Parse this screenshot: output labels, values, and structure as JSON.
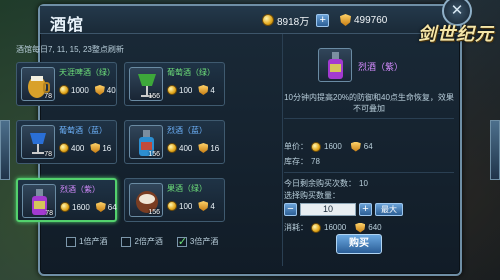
{
  "window": {
    "title": "酒馆"
  },
  "resources": {
    "gold": "8918万",
    "gems": "499760"
  },
  "logo": "剑世纪元",
  "notice": "酒馆每日7, 11, 15, 23整点刷新",
  "items": [
    {
      "name": "天涯啤酒（绿）",
      "count": "78",
      "gold": "1000",
      "gems": "40",
      "quality": "green"
    },
    {
      "name": "葡萄酒（绿）",
      "count": "156",
      "gold": "100",
      "gems": "4",
      "quality": "green"
    },
    {
      "name": "葡萄酒（蓝）",
      "count": "78",
      "gold": "400",
      "gems": "16",
      "quality": "blue"
    },
    {
      "name": "烈酒（蓝）",
      "count": "156",
      "gold": "400",
      "gems": "16",
      "quality": "blue"
    },
    {
      "name": "烈酒（紫）",
      "count": "78",
      "gold": "1600",
      "gems": "64",
      "quality": "purple"
    },
    {
      "name": "果酒（绿）",
      "count": "156",
      "gold": "100",
      "gems": "4",
      "quality": "green"
    }
  ],
  "checks": [
    {
      "label": "1倍产酒",
      "checked": false
    },
    {
      "label": "2倍产酒",
      "checked": false
    },
    {
      "label": "3倍产酒",
      "checked": true
    }
  ],
  "detail": {
    "name": "烈酒（紫）",
    "desc": "10分钟内提高20%的防御和40点生命恢复，效果不可叠加",
    "price_label": "单价：",
    "price_gold": "1600",
    "price_gems": "64",
    "stock_label": "库存：",
    "stock": "78",
    "remain_label": "今日剩余购买次数：",
    "remain": "10",
    "select_label": "选择购买数量：",
    "qty": "10",
    "max_label": "最大",
    "cost_label": "消耗：",
    "cost_gold": "16000",
    "cost_gems": "640",
    "buy_label": "购买"
  }
}
